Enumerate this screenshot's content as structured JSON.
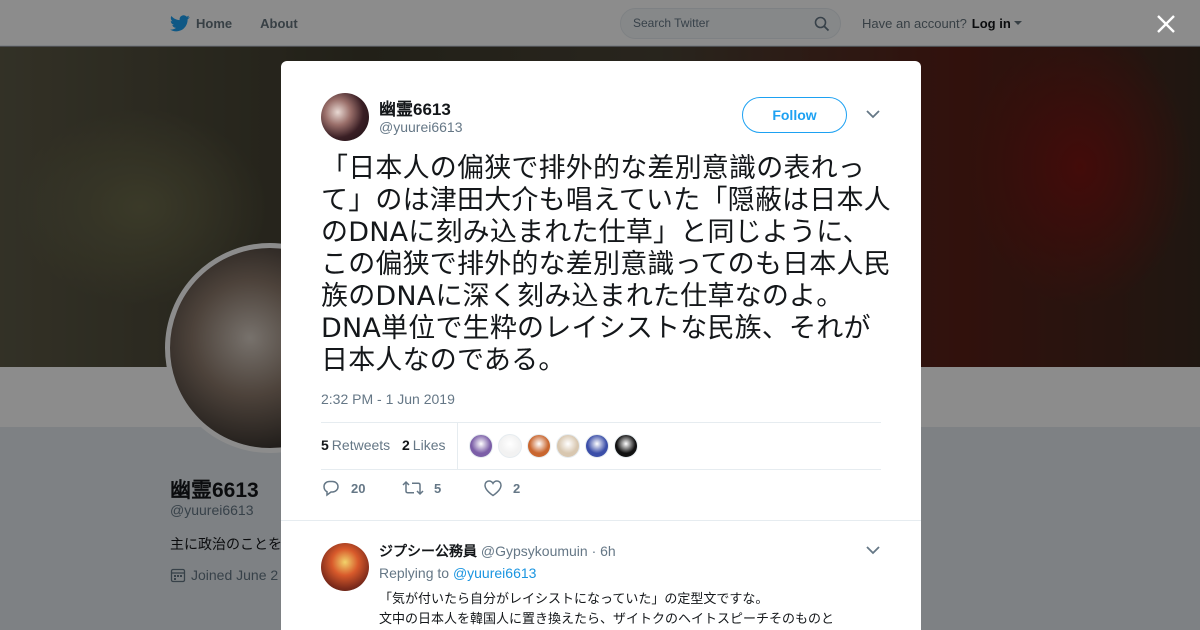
{
  "topbar": {
    "home_label": "Home",
    "about_label": "About",
    "search_placeholder": "Search Twitter",
    "account_prompt": "Have an account?",
    "login_label": "Log in"
  },
  "background_profile": {
    "name": "幽霊6613",
    "handle": "@yuurei6613",
    "bio": "主に政治のことを",
    "joined": "Joined June 2"
  },
  "tweet": {
    "user_name": "幽霊6613",
    "user_handle": "@yuurei6613",
    "follow_label": "Follow",
    "text": "「日本人の偏狭で排外的な差別意識の表れって」のは津田大介も唱えていた「隠蔽は日本人のDNAに刻み込まれた仕草」と同じように、この偏狭で排外的な差別意識ってのも日本人民族のDNAに深く刻み込まれた仕草なのよ。DNA単位で生粋のレイシストな民族、それが日本人なのである。",
    "timestamp": "2:32 PM - 1 Jun 2019",
    "retweets_count": "5",
    "retweets_label": "Retweets",
    "likes_count": "2",
    "likes_label": "Likes",
    "replies": "20",
    "retweets": "5",
    "likes": "2",
    "liker_colors": [
      "#7b5ea7",
      "#f2f2f2",
      "#c9662f",
      "#d8c7b0",
      "#3b4ea8",
      "#111111"
    ]
  },
  "reply": {
    "name": "ジプシー公務員",
    "handle": "@Gypsykoumuin",
    "age": "· 6h",
    "replying_prefix": "Replying to",
    "replying_to": "@yuurei6613",
    "line1": "「気が付いたら自分がレイシストになっていた」の定型文ですな。",
    "line2": "文中の日本人を韓国人に置き換えたら、ザイトクのヘイトスピーチそのものと"
  },
  "colors": {
    "accent": "#1da1f2",
    "text_secondary": "#657786"
  }
}
